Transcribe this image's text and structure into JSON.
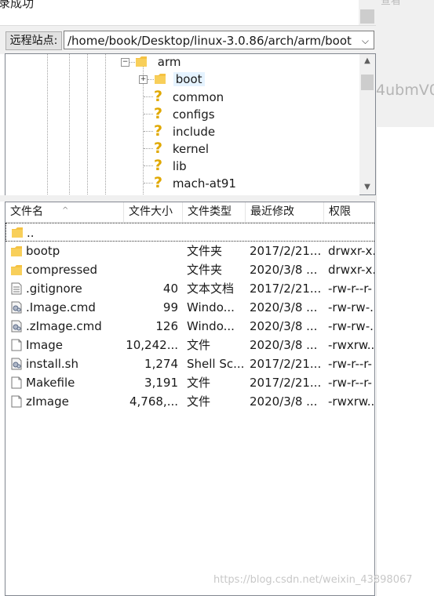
{
  "log": {
    "text": "录成功"
  },
  "right_pane": {
    "label_top": "查看",
    "label_mid": "4ubmV0"
  },
  "site": {
    "label": "远程站点:",
    "path": "/home/book/Desktop/linux-3.0.86/arch/arm/boot"
  },
  "tree": {
    "items": [
      {
        "label": "arm",
        "icon": "folder-icon",
        "expander": "minus"
      },
      {
        "label": "boot",
        "icon": "folder-icon",
        "expander": "plus",
        "selected": true
      },
      {
        "label": "common",
        "icon": "question-icon"
      },
      {
        "label": "configs",
        "icon": "question-icon"
      },
      {
        "label": "include",
        "icon": "question-icon"
      },
      {
        "label": "kernel",
        "icon": "question-icon"
      },
      {
        "label": "lib",
        "icon": "question-icon"
      },
      {
        "label": "mach-at91",
        "icon": "question-icon"
      }
    ]
  },
  "filelist": {
    "columns": [
      "文件名",
      "文件大小",
      "文件类型",
      "最近修改",
      "权限"
    ],
    "parent": "..",
    "rows": [
      {
        "name": "bootp",
        "size": "",
        "type": "文件夹",
        "date": "2017/2/21...",
        "perm": "drwxr-x...",
        "icon": "folder-icon"
      },
      {
        "name": "compressed",
        "size": "",
        "type": "文件夹",
        "date": "2020/3/8 ...",
        "perm": "drwxr-x...",
        "icon": "folder-icon"
      },
      {
        "name": ".gitignore",
        "size": "40",
        "type": "文本文档",
        "date": "2017/2/21...",
        "perm": "-rw-r--r-",
        "icon": "text-file-icon"
      },
      {
        "name": ".Image.cmd",
        "size": "99",
        "type": "Windo...",
        "date": "2020/3/8 ...",
        "perm": "-rw-rw-...",
        "icon": "script-file-icon"
      },
      {
        "name": ".zImage.cmd",
        "size": "126",
        "type": "Windo...",
        "date": "2020/3/8 ...",
        "perm": "-rw-rw-...",
        "icon": "script-file-icon"
      },
      {
        "name": "Image",
        "size": "10,242...",
        "type": "文件",
        "date": "2020/3/8 ...",
        "perm": "-rwxrw...",
        "icon": "blank-file-icon"
      },
      {
        "name": "install.sh",
        "size": "1,274",
        "type": "Shell Sc...",
        "date": "2017/2/21...",
        "perm": "-rw-r--r-",
        "icon": "script-file-icon"
      },
      {
        "name": "Makefile",
        "size": "3,191",
        "type": "文件",
        "date": "2017/2/21...",
        "perm": "-rw-r--r-",
        "icon": "blank-file-icon"
      },
      {
        "name": "zImage",
        "size": "4,768,...",
        "type": "文件",
        "date": "2020/3/8 ...",
        "perm": "-rwxrw...",
        "icon": "blank-file-icon"
      }
    ]
  },
  "watermark": "https://blog.csdn.net/weixin_43898067",
  "colors": {
    "folder": "#f5c242",
    "question": "#e0a800",
    "selection": "#e5f3ff",
    "border": "#828790"
  }
}
